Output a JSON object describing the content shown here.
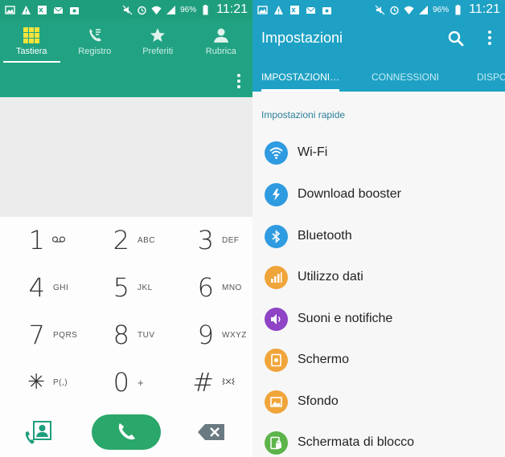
{
  "status_bar": {
    "battery": "96%",
    "time": "11:21"
  },
  "dialer": {
    "tabs": [
      {
        "label": "Tastiera",
        "icon": "dialpad-icon",
        "active": true
      },
      {
        "label": "Registro",
        "icon": "call-log-icon",
        "active": false
      },
      {
        "label": "Preferiti",
        "icon": "star-icon",
        "active": false
      },
      {
        "label": "Rubrica",
        "icon": "person-icon",
        "active": false
      }
    ],
    "keys": [
      {
        "digit": "1",
        "letters": "",
        "icon": "voicemail-icon"
      },
      {
        "digit": "2",
        "letters": "ABC"
      },
      {
        "digit": "3",
        "letters": "DEF"
      },
      {
        "digit": "4",
        "letters": "GHI"
      },
      {
        "digit": "5",
        "letters": "JKL"
      },
      {
        "digit": "6",
        "letters": "MNO"
      },
      {
        "digit": "7",
        "letters": "PQRS"
      },
      {
        "digit": "8",
        "letters": "TUV"
      },
      {
        "digit": "9",
        "letters": "WXYZ"
      },
      {
        "digit": "✳",
        "letters": "P(,)"
      },
      {
        "digit": "0",
        "letters": "+"
      },
      {
        "digit": "#",
        "letters": "",
        "icon": "vibrate-icon"
      }
    ],
    "accent_color": "#21a383",
    "call_color": "#2aa76a"
  },
  "settings": {
    "title": "Impostazioni",
    "tabs": [
      {
        "label": "IMPOSTAZIONI…",
        "active": true
      },
      {
        "label": "CONNESSIONI",
        "active": false
      },
      {
        "label": "DISPO",
        "active": false
      }
    ],
    "section_title": "Impostazioni rapide",
    "items": [
      {
        "label": "Wi-Fi",
        "icon": "wifi-icon",
        "color": "#2f9be0"
      },
      {
        "label": "Download booster",
        "icon": "download-booster-icon",
        "color": "#2f9be0"
      },
      {
        "label": "Bluetooth",
        "icon": "bluetooth-icon",
        "color": "#2f9be0"
      },
      {
        "label": "Utilizzo dati",
        "icon": "data-usage-icon",
        "color": "#f0a53a"
      },
      {
        "label": "Suoni e notifiche",
        "icon": "sound-icon",
        "color": "#8e44c5"
      },
      {
        "label": "Schermo",
        "icon": "display-icon",
        "color": "#f0a53a"
      },
      {
        "label": "Sfondo",
        "icon": "wallpaper-icon",
        "color": "#f0a53a"
      },
      {
        "label": "Schermata di blocco",
        "icon": "lock-screen-icon",
        "color": "#5cb44a"
      }
    ],
    "accent_color": "#1ea1c4"
  }
}
